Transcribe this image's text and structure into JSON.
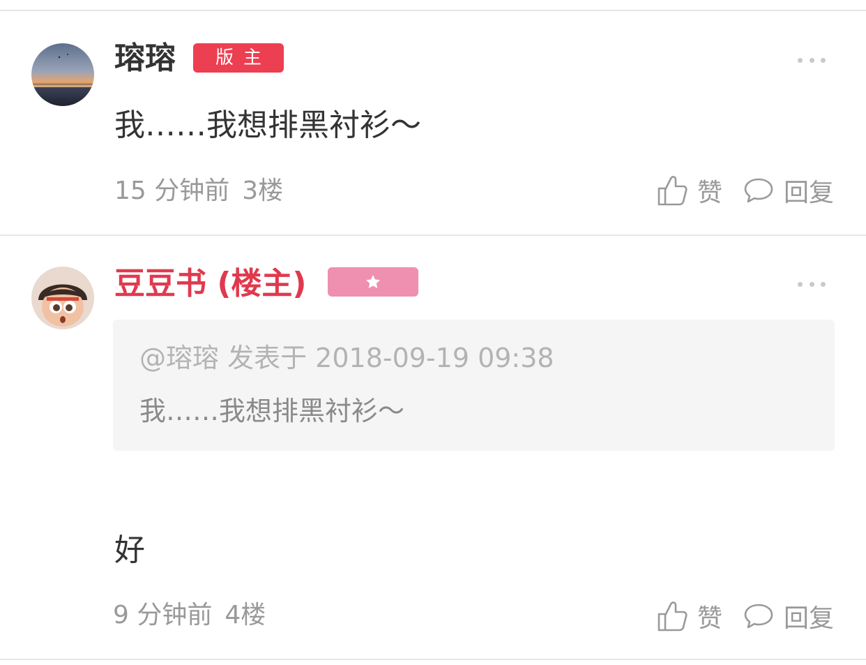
{
  "posts": [
    {
      "author": "瑢瑢",
      "role_badge": "版主",
      "content": "我……我想排黑衬衫～",
      "time": "15 分钟前",
      "floor": "3楼",
      "like_label": "赞",
      "reply_label": "回复"
    },
    {
      "author": "豆豆书 (楼主)",
      "role_badge_icon": "star-icon",
      "quote": {
        "header": "@瑢瑢 发表于 2018-09-19 09:38",
        "body": "我……我想排黑衬衫～"
      },
      "content": "好",
      "time": "9 分钟前",
      "floor": "4楼",
      "like_label": "赞",
      "reply_label": "回复"
    }
  ],
  "colors": {
    "op_name": "#e0394e",
    "moderator_badge": "#ec3f51",
    "star_badge": "#ef90b1",
    "meta_text": "#999999"
  }
}
